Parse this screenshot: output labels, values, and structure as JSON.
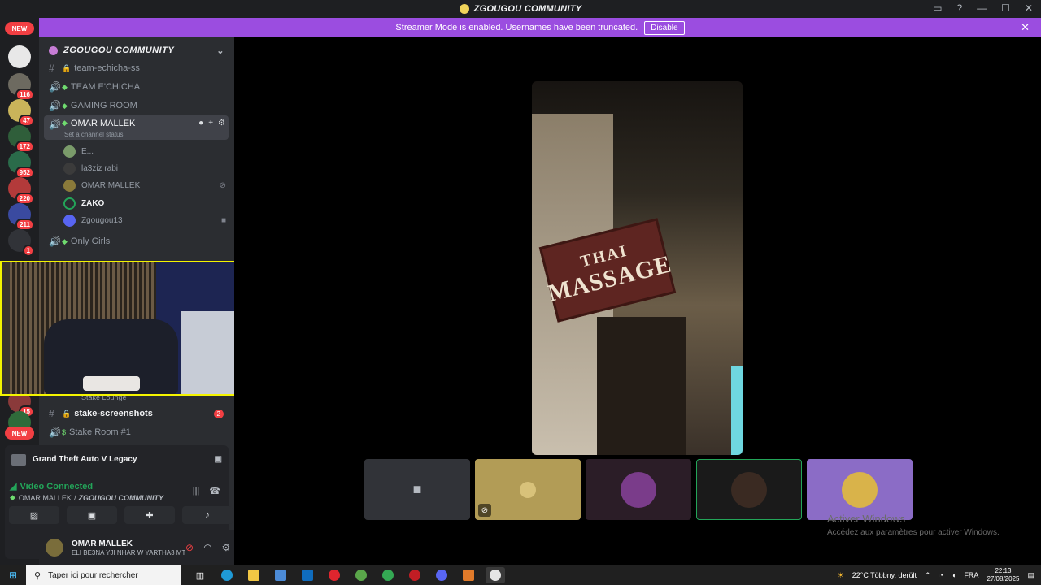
{
  "window": {
    "title": "ZGOUGOU COMMUNITY",
    "controls": [
      "▭",
      "?",
      "—",
      "☐",
      "✕"
    ]
  },
  "banner": {
    "message": "Streamer Mode is enabled. Usernames have been truncated.",
    "disable_label": "Disable",
    "close": "✕"
  },
  "guilds": {
    "new_label": "NEW",
    "badges": [
      "116",
      "47",
      "172",
      "952",
      "220",
      "211",
      "1",
      "15"
    ]
  },
  "server": {
    "name": "ZGOUGOU COMMUNITY",
    "chevron": "⌄"
  },
  "channels": {
    "team_echicha_ss": "team-echicha-ss",
    "team_echicha": "TEAM E'CHICHA",
    "gaming_room": "GAMING ROOM",
    "omar_mallek": "OMAR MALLEK",
    "omar_status": "Set a channel status",
    "only_girls": "Only Girls",
    "stake_lounge": "Stake Lounge",
    "stake_screenshots": "stake-screenshots",
    "stake_screenshots_badge": "2",
    "stake_room": "Stake Room #1"
  },
  "members": [
    {
      "name": "E...",
      "color": "#7a9b6a"
    },
    {
      "name": "la3ziz rabi",
      "color": "#3b3b3b"
    },
    {
      "name": "OMAR MALLEK",
      "color": "#8a7a3a"
    },
    {
      "name": "ZAKO",
      "color": "#2b2d31"
    },
    {
      "name": "Zgougou13",
      "color": "#5865f2"
    }
  ],
  "voice": {
    "game": "Grand Theft Auto V Legacy",
    "connected": "Video Connected",
    "location_channel": "OMAR MALLEK",
    "location_server": "ZGOUGOU COMMUNITY"
  },
  "user": {
    "name": "OMAR MALLEK",
    "status": "ELI BE3NA YJI NHAR W YARTHA3 MT..."
  },
  "video": {
    "sign_line1": "THAI",
    "sign_line2": "MASSAGE"
  },
  "watermark": {
    "line1": "Activer Windows",
    "line2": "Accédez aux paramètres pour activer Windows."
  },
  "taskbar": {
    "search_placeholder": "Taper ici pour rechercher",
    "weather": "22°C  Többny. derült",
    "language": "FRA",
    "time": "22:13",
    "date": "27/08/2025"
  },
  "colors": {
    "banner": "#9b4de0",
    "accent_green": "#23a559",
    "badge_red": "#f23f43",
    "pip_border": "#f4f400"
  }
}
